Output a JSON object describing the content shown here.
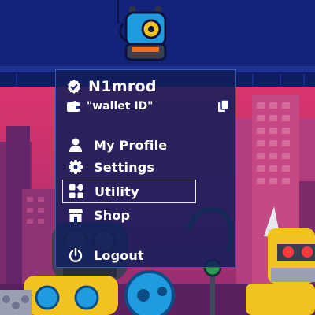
{
  "user": {
    "name": "N1mrod",
    "wallet": "\"wallet ID\""
  },
  "menu": {
    "items": [
      {
        "label": "My Profile",
        "icon": "person-icon"
      },
      {
        "label": "Settings",
        "icon": "gear-icon"
      },
      {
        "label": "Utility",
        "icon": "grid-icon",
        "selected": true
      },
      {
        "label": "Shop",
        "icon": "shop-icon"
      },
      {
        "label": "Logout",
        "icon": "power-icon"
      }
    ]
  },
  "colors": {
    "header_bg": "#13237a",
    "menu_bg": "#121e5a",
    "accent_yellow": "#f2c21e",
    "robot_blue": "#1f9be0"
  }
}
